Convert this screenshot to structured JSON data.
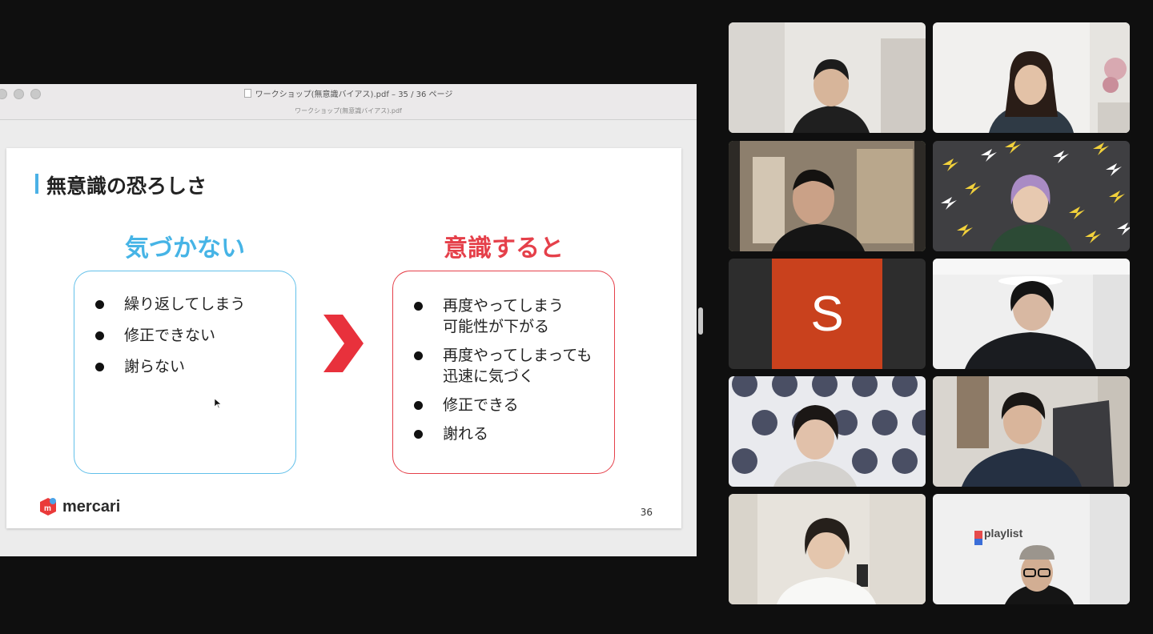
{
  "pdf_window": {
    "title": "ワークショップ(無意識バイアス).pdf – 35 / 36 ページ",
    "subtitle": "ワークショップ(無意識バイアス).pdf"
  },
  "slide": {
    "title": "無意識の恐ろしさ",
    "left": {
      "heading": "気づかない",
      "items": [
        "繰り返してしまう",
        "修正できない",
        "謝らない"
      ]
    },
    "right": {
      "heading": "意識すると",
      "items": [
        "再度やってしまう\n可能性が下がる",
        "再度やってしまっても\n迅速に気づく",
        "修正できる",
        "謝れる"
      ]
    },
    "logo_text": "mercari",
    "page_number": "36"
  },
  "gallery": {
    "participants": [
      {
        "id": "p1",
        "type": "video",
        "active": false
      },
      {
        "id": "p2",
        "type": "video",
        "active": false
      },
      {
        "id": "p3",
        "type": "video",
        "active": true
      },
      {
        "id": "p4",
        "type": "video",
        "active": false
      },
      {
        "id": "p5",
        "type": "avatar",
        "letter": "S",
        "active": false
      },
      {
        "id": "p6",
        "type": "video",
        "active": false
      },
      {
        "id": "p7",
        "type": "video",
        "active": false
      },
      {
        "id": "p8",
        "type": "video",
        "active": false
      },
      {
        "id": "p9",
        "type": "video",
        "active": false
      },
      {
        "id": "p10",
        "type": "video",
        "active": false,
        "backdrop_text": "playlist"
      }
    ]
  },
  "colors": {
    "accent_blue": "#46b4e6",
    "accent_red": "#e5404a",
    "speaker_border": "#5ccd4a",
    "avatar_bg": "#c9411d"
  }
}
